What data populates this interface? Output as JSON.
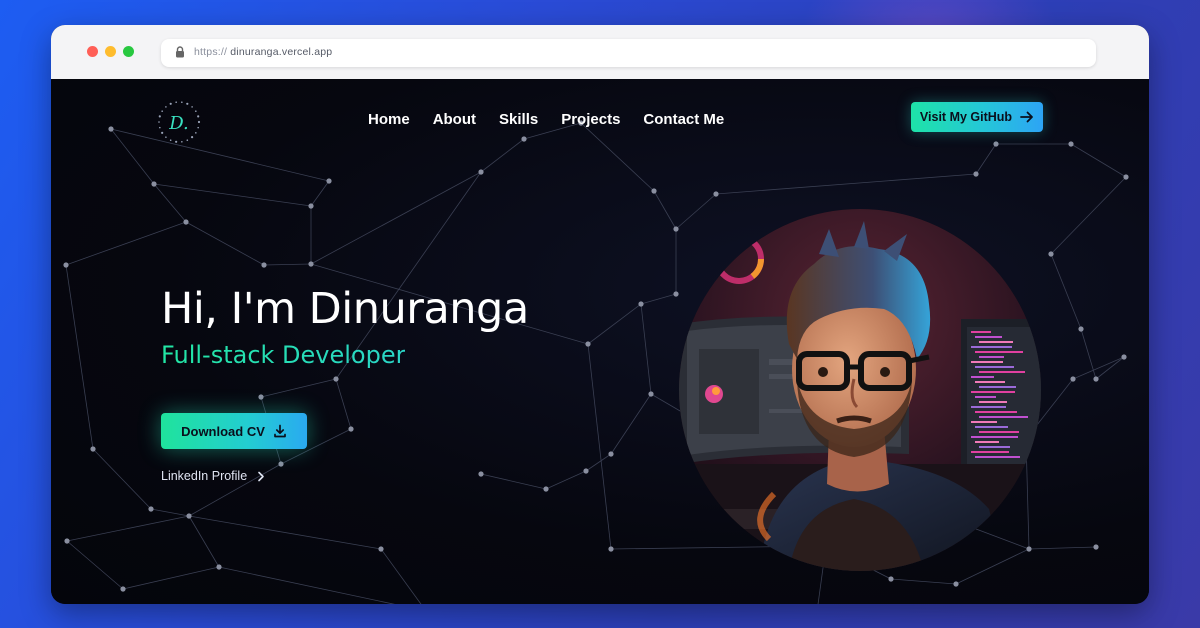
{
  "browser": {
    "url_scheme": "https://",
    "url_host": "dinuranga.vercel.app",
    "lock_icon": "lock-icon"
  },
  "nav": {
    "items": [
      {
        "label": "Home"
      },
      {
        "label": "About"
      },
      {
        "label": "Skills"
      },
      {
        "label": "Projects"
      },
      {
        "label": "Contact Me"
      }
    ],
    "github_button": "Visit My GitHub",
    "github_icon": "arrow-right-icon"
  },
  "logo": {
    "text": "D."
  },
  "hero": {
    "title": "Hi, I'm Dinuranga",
    "subtitle": "Full-stack Developer",
    "cv_button": "Download CV",
    "cv_icon": "download-icon",
    "linkedin_label": "LinkedIn Profile",
    "linkedin_icon": "chevron-right-icon"
  },
  "colors": {
    "accent_green": "#1ee3a8",
    "accent_blue": "#2da4f5",
    "page_bg": "#06070f"
  }
}
